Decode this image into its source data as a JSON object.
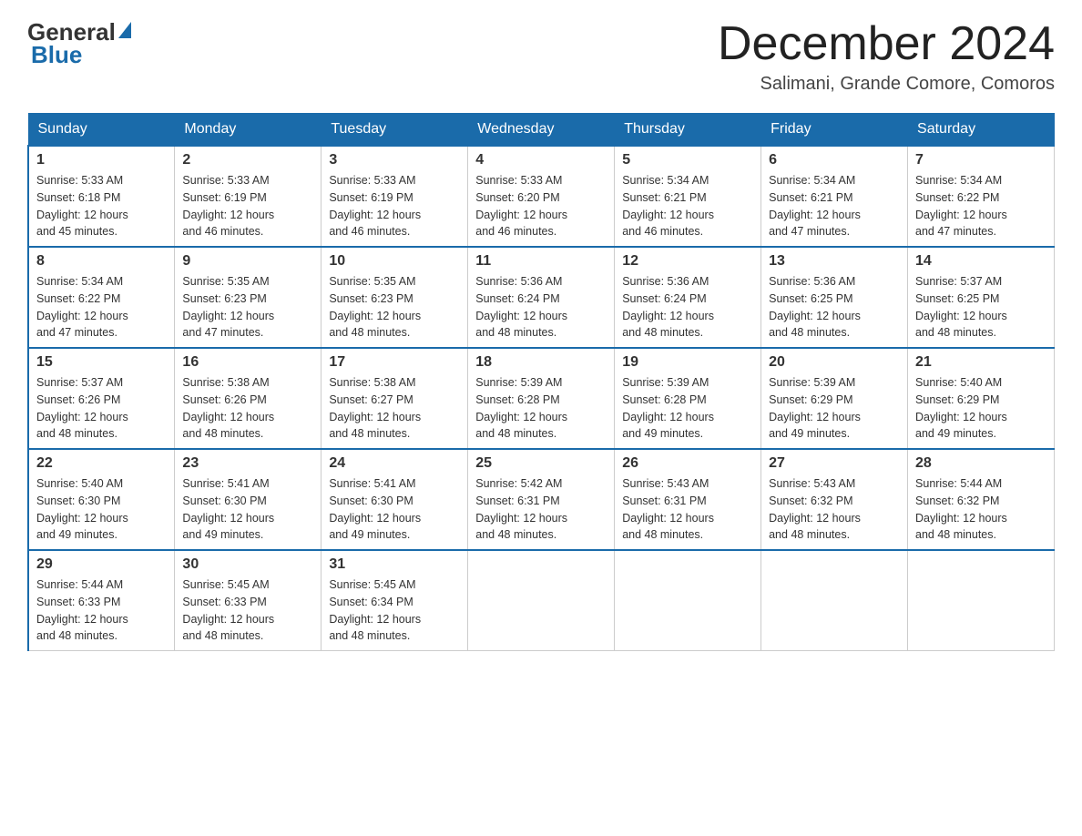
{
  "header": {
    "logo_general": "General",
    "logo_blue": "Blue",
    "title": "December 2024",
    "subtitle": "Salimani, Grande Comore, Comoros"
  },
  "days_of_week": [
    "Sunday",
    "Monday",
    "Tuesday",
    "Wednesday",
    "Thursday",
    "Friday",
    "Saturday"
  ],
  "weeks": [
    [
      {
        "num": "1",
        "sunrise": "5:33 AM",
        "sunset": "6:18 PM",
        "daylight": "12 hours and 45 minutes."
      },
      {
        "num": "2",
        "sunrise": "5:33 AM",
        "sunset": "6:19 PM",
        "daylight": "12 hours and 46 minutes."
      },
      {
        "num": "3",
        "sunrise": "5:33 AM",
        "sunset": "6:19 PM",
        "daylight": "12 hours and 46 minutes."
      },
      {
        "num": "4",
        "sunrise": "5:33 AM",
        "sunset": "6:20 PM",
        "daylight": "12 hours and 46 minutes."
      },
      {
        "num": "5",
        "sunrise": "5:34 AM",
        "sunset": "6:21 PM",
        "daylight": "12 hours and 46 minutes."
      },
      {
        "num": "6",
        "sunrise": "5:34 AM",
        "sunset": "6:21 PM",
        "daylight": "12 hours and 47 minutes."
      },
      {
        "num": "7",
        "sunrise": "5:34 AM",
        "sunset": "6:22 PM",
        "daylight": "12 hours and 47 minutes."
      }
    ],
    [
      {
        "num": "8",
        "sunrise": "5:34 AM",
        "sunset": "6:22 PM",
        "daylight": "12 hours and 47 minutes."
      },
      {
        "num": "9",
        "sunrise": "5:35 AM",
        "sunset": "6:23 PM",
        "daylight": "12 hours and 47 minutes."
      },
      {
        "num": "10",
        "sunrise": "5:35 AM",
        "sunset": "6:23 PM",
        "daylight": "12 hours and 48 minutes."
      },
      {
        "num": "11",
        "sunrise": "5:36 AM",
        "sunset": "6:24 PM",
        "daylight": "12 hours and 48 minutes."
      },
      {
        "num": "12",
        "sunrise": "5:36 AM",
        "sunset": "6:24 PM",
        "daylight": "12 hours and 48 minutes."
      },
      {
        "num": "13",
        "sunrise": "5:36 AM",
        "sunset": "6:25 PM",
        "daylight": "12 hours and 48 minutes."
      },
      {
        "num": "14",
        "sunrise": "5:37 AM",
        "sunset": "6:25 PM",
        "daylight": "12 hours and 48 minutes."
      }
    ],
    [
      {
        "num": "15",
        "sunrise": "5:37 AM",
        "sunset": "6:26 PM",
        "daylight": "12 hours and 48 minutes."
      },
      {
        "num": "16",
        "sunrise": "5:38 AM",
        "sunset": "6:26 PM",
        "daylight": "12 hours and 48 minutes."
      },
      {
        "num": "17",
        "sunrise": "5:38 AM",
        "sunset": "6:27 PM",
        "daylight": "12 hours and 48 minutes."
      },
      {
        "num": "18",
        "sunrise": "5:39 AM",
        "sunset": "6:28 PM",
        "daylight": "12 hours and 48 minutes."
      },
      {
        "num": "19",
        "sunrise": "5:39 AM",
        "sunset": "6:28 PM",
        "daylight": "12 hours and 49 minutes."
      },
      {
        "num": "20",
        "sunrise": "5:39 AM",
        "sunset": "6:29 PM",
        "daylight": "12 hours and 49 minutes."
      },
      {
        "num": "21",
        "sunrise": "5:40 AM",
        "sunset": "6:29 PM",
        "daylight": "12 hours and 49 minutes."
      }
    ],
    [
      {
        "num": "22",
        "sunrise": "5:40 AM",
        "sunset": "6:30 PM",
        "daylight": "12 hours and 49 minutes."
      },
      {
        "num": "23",
        "sunrise": "5:41 AM",
        "sunset": "6:30 PM",
        "daylight": "12 hours and 49 minutes."
      },
      {
        "num": "24",
        "sunrise": "5:41 AM",
        "sunset": "6:30 PM",
        "daylight": "12 hours and 49 minutes."
      },
      {
        "num": "25",
        "sunrise": "5:42 AM",
        "sunset": "6:31 PM",
        "daylight": "12 hours and 48 minutes."
      },
      {
        "num": "26",
        "sunrise": "5:43 AM",
        "sunset": "6:31 PM",
        "daylight": "12 hours and 48 minutes."
      },
      {
        "num": "27",
        "sunrise": "5:43 AM",
        "sunset": "6:32 PM",
        "daylight": "12 hours and 48 minutes."
      },
      {
        "num": "28",
        "sunrise": "5:44 AM",
        "sunset": "6:32 PM",
        "daylight": "12 hours and 48 minutes."
      }
    ],
    [
      {
        "num": "29",
        "sunrise": "5:44 AM",
        "sunset": "6:33 PM",
        "daylight": "12 hours and 48 minutes."
      },
      {
        "num": "30",
        "sunrise": "5:45 AM",
        "sunset": "6:33 PM",
        "daylight": "12 hours and 48 minutes."
      },
      {
        "num": "31",
        "sunrise": "5:45 AM",
        "sunset": "6:34 PM",
        "daylight": "12 hours and 48 minutes."
      },
      null,
      null,
      null,
      null
    ]
  ],
  "labels": {
    "sunrise": "Sunrise:",
    "sunset": "Sunset:",
    "daylight": "Daylight:"
  }
}
